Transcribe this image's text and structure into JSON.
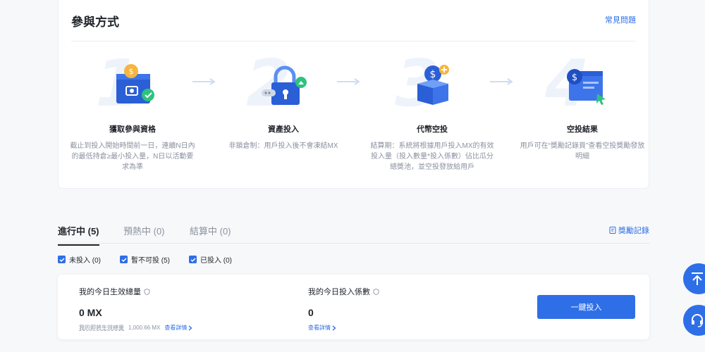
{
  "participation": {
    "title": "參與方式",
    "faq_label": "常見問題",
    "steps": [
      {
        "number": "1",
        "title": "獲取參與資格",
        "desc": "截止到投入開始時間前一日，連續N日內的最低持倉≥最小投入量，N日以活動要求為準"
      },
      {
        "number": "2",
        "title": "資產投入",
        "desc": "非鎖倉制：用戶投入後不會凍結MX"
      },
      {
        "number": "3",
        "title": "代幣空投",
        "desc": "結算期：系統將根據用戶投入MX的有效投入量（投入數量*投入係數）佔比瓜分總獎池，並空投發放給用戶"
      },
      {
        "number": "4",
        "title": "空投結果",
        "desc": "用戶可在“獎勵記錄頁”查看空投獎勵發放明細"
      }
    ]
  },
  "tabs": {
    "items": [
      {
        "label": "進行中 (5)",
        "active": true
      },
      {
        "label": "預熱中 (0)",
        "active": false
      },
      {
        "label": "結算中 (0)",
        "active": false
      }
    ],
    "record_label": "獎勵記錄"
  },
  "filters": [
    {
      "label": "未投入 (0)",
      "checked": true
    },
    {
      "label": "暫不可投 (5)",
      "checked": true
    },
    {
      "label": "已投入 (0)",
      "checked": true
    }
  ],
  "summary": {
    "effective": {
      "label": "我的今日生效總量",
      "value": "0 MX",
      "sub_label": "我的即將生效總量",
      "sub_value": "1,000.66 MX",
      "detail_label": "查看詳情"
    },
    "coefficient": {
      "label": "我的今日投入係數",
      "value": "0",
      "detail_label": "查看詳情"
    },
    "button_label": "一鍵投入"
  },
  "colors": {
    "accent": "#2e6fe8",
    "text": "#1f2329",
    "muted": "#8a919f"
  },
  "icons": [
    "back-to-top-icon",
    "customer-service-icon",
    "record-icon",
    "checkbox-checked-icon",
    "shield-icon",
    "chevron-right-icon"
  ]
}
